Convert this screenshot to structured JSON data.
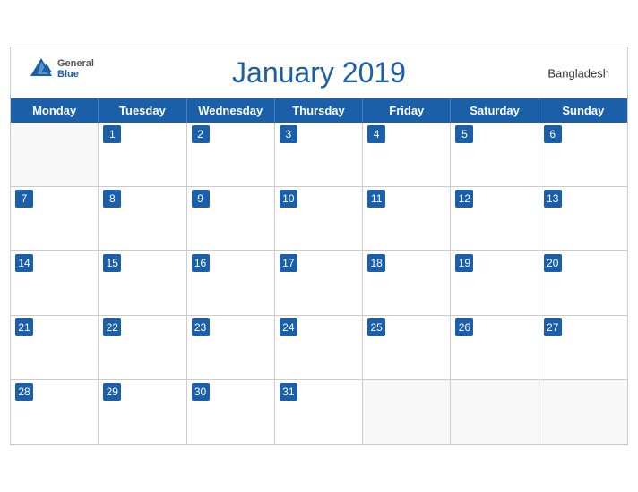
{
  "header": {
    "title": "January 2019",
    "country": "Bangladesh",
    "logo_general": "General",
    "logo_blue": "Blue"
  },
  "days_of_week": [
    "Monday",
    "Tuesday",
    "Wednesday",
    "Thursday",
    "Friday",
    "Saturday",
    "Sunday"
  ],
  "weeks": [
    [
      null,
      1,
      2,
      3,
      4,
      5,
      6
    ],
    [
      7,
      8,
      9,
      10,
      11,
      12,
      13
    ],
    [
      14,
      15,
      16,
      17,
      18,
      19,
      20
    ],
    [
      21,
      22,
      23,
      24,
      25,
      26,
      27
    ],
    [
      28,
      29,
      30,
      31,
      null,
      null,
      null
    ]
  ]
}
